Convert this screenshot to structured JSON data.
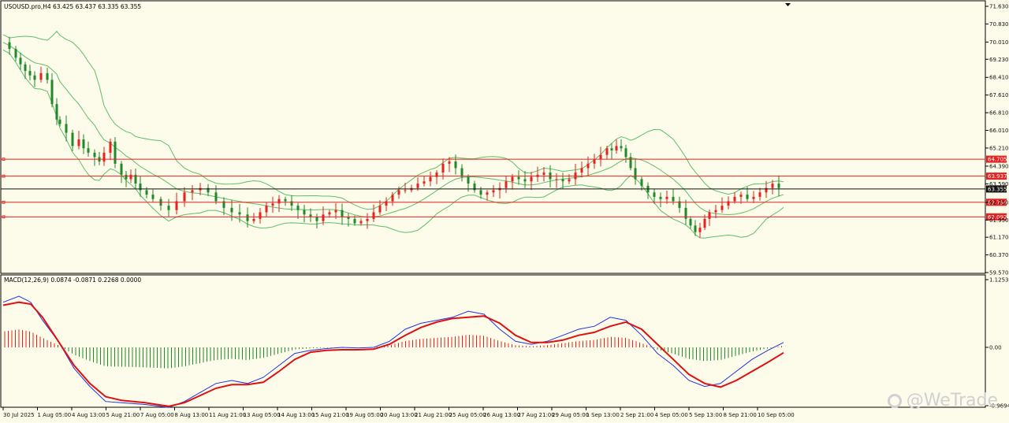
{
  "main": {
    "header": "USOUSD.pro,H4  63.425 63.437 63.335 63.355",
    "y_ticks": [
      "71.630",
      "70.830",
      "70.010",
      "69.230",
      "68.410",
      "67.610",
      "66.810",
      "66.010",
      "65.210",
      "64.390",
      "63.590",
      "62.750",
      "61.950",
      "61.170",
      "60.370",
      "59.570"
    ],
    "levels": [
      {
        "label": "64.705",
        "value": 64.705,
        "color": "#e8201f"
      },
      {
        "label": "63.937",
        "value": 63.937,
        "color": "#e8201f"
      },
      {
        "label": "62.754",
        "value": 62.754,
        "color": "#e8201f"
      },
      {
        "label": "62.092",
        "value": 62.092,
        "color": "#e8201f"
      }
    ],
    "current": {
      "label": "63.355",
      "value": 63.355,
      "color": "#111111"
    }
  },
  "macd_panel": {
    "header": "MACD(12,26,9) 0.0874 -0.0871 0.2268 0.0000",
    "y_ticks": [
      "1.1253",
      "0.00",
      "-0.9694"
    ]
  },
  "x_ticks": [
    "30 Jul 2025",
    "1 Aug 05:00",
    "4 Aug 13:00",
    "5 Aug 21:00",
    "7 Aug 05:00",
    "8 Aug 13:00",
    "11 Aug 21:00",
    "13 Aug 05:00",
    "14 Aug 13:00",
    "15 Aug 21:00",
    "19 Aug 05:00",
    "20 Aug 13:00",
    "21 Aug 21:00",
    "25 Aug 05:00",
    "26 Aug 13:00",
    "27 Aug 21:00",
    "29 Aug 05:00",
    "1 Sep 13:00",
    "2 Sep 21:00",
    "4 Sep 05:00",
    "5 Sep 13:00",
    "8 Sep 21:00",
    "10 Sep 05:00"
  ],
  "watermark": "@WeTrade",
  "colors": {
    "bull": "#e8201f",
    "bear": "#1f8a2a",
    "band": "#5cc06a",
    "macd": "#2233dd",
    "signal": "#dd1111",
    "hist_pos": "#e8201f",
    "hist_neg": "#1f8a2a",
    "background": "#fdfbea"
  },
  "chart_data": [
    {
      "type": "candlestick",
      "symbol": "USOUSD.pro",
      "timeframe": "H4",
      "ohlc": {
        "open": 63.425,
        "high": 63.437,
        "low": 63.335,
        "close": 63.355
      },
      "ylim": [
        59.57,
        71.63
      ],
      "close_path": {
        "x": [
          0,
          8,
          16,
          22,
          28,
          34,
          40,
          48,
          56,
          62,
          68,
          72,
          80,
          88,
          96,
          102,
          108,
          116,
          122,
          128,
          136,
          142,
          150,
          156,
          162,
          168,
          174,
          182,
          190,
          200,
          210,
          220,
          230,
          240,
          250,
          260,
          270,
          280,
          290,
          300,
          310,
          318,
          326,
          334,
          342,
          350,
          358,
          366,
          374,
          382,
          390,
          398,
          406,
          414,
          422,
          430,
          438,
          446,
          454,
          462,
          470,
          478,
          486,
          494,
          502,
          510,
          518,
          526,
          534,
          542,
          550,
          558,
          566,
          574,
          582,
          590,
          598,
          606,
          614,
          622,
          630,
          638,
          646,
          654,
          662,
          670,
          678,
          686,
          694,
          702,
          710,
          718,
          726,
          734,
          742,
          750,
          758,
          766,
          772,
          778,
          784,
          790,
          796,
          802,
          810,
          818,
          826,
          834,
          842,
          850,
          858,
          866,
          872,
          878,
          884,
          890,
          896,
          904,
          912,
          920,
          928,
          936,
          944,
          952,
          960,
          968,
          976,
          984,
          990
        ],
        "values": [
          70.0,
          69.7,
          69.3,
          69.0,
          68.7,
          68.5,
          68.3,
          68.6,
          68.3,
          67.2,
          66.5,
          66.3,
          65.9,
          65.3,
          65.6,
          65.2,
          65.0,
          64.8,
          64.6,
          65.0,
          65.5,
          64.5,
          64.0,
          63.8,
          64.0,
          63.6,
          63.3,
          63.1,
          62.9,
          62.6,
          62.4,
          62.8,
          63.2,
          63.3,
          63.4,
          63.2,
          62.8,
          62.5,
          62.3,
          62.2,
          61.9,
          62.0,
          62.3,
          62.6,
          62.7,
          62.9,
          62.8,
          62.6,
          62.4,
          62.2,
          62.1,
          61.9,
          62.2,
          62.3,
          62.4,
          62.1,
          62.0,
          61.8,
          61.9,
          62.0,
          62.3,
          62.6,
          62.8,
          63.1,
          63.3,
          63.3,
          63.4,
          63.6,
          63.7,
          63.9,
          64.1,
          64.5,
          64.6,
          64.3,
          63.9,
          63.6,
          63.3,
          63.1,
          63.2,
          63.3,
          63.4,
          63.7,
          63.9,
          63.8,
          63.7,
          63.9,
          64.0,
          64.1,
          63.8,
          63.8,
          63.7,
          63.8,
          64.1,
          64.3,
          64.5,
          64.7,
          64.9,
          65.2,
          65.1,
          65.3,
          65.2,
          64.8,
          64.3,
          63.8,
          63.5,
          63.2,
          63.0,
          62.9,
          63.0,
          62.8,
          62.5,
          62.0,
          61.7,
          61.4,
          61.6,
          62.0,
          62.3,
          62.4,
          62.6,
          62.8,
          63.0,
          63.1,
          62.9,
          63.0,
          63.2,
          63.4,
          63.6,
          63.4
        ]
      }
    },
    {
      "type": "line",
      "title": "MACD(12,26,9)",
      "macd_value": 0.0874,
      "signal_value": -0.0871,
      "values_header": [
        0.0874,
        -0.0871,
        0.2268,
        0.0
      ],
      "ylim": [
        -0.9694,
        1.1253
      ],
      "x": [
        0,
        20,
        35,
        50,
        70,
        90,
        110,
        130,
        150,
        180,
        210,
        230,
        250,
        270,
        290,
        310,
        330,
        350,
        370,
        390,
        410,
        430,
        450,
        470,
        490,
        510,
        530,
        550,
        570,
        590,
        610,
        630,
        650,
        670,
        690,
        710,
        730,
        750,
        770,
        790,
        810,
        830,
        850,
        870,
        890,
        910,
        930,
        950,
        970,
        990
      ],
      "series": [
        {
          "name": "MACD",
          "values": [
            0.75,
            0.85,
            0.75,
            0.45,
            0.1,
            -0.35,
            -0.65,
            -0.9,
            -0.92,
            -0.95,
            -1.0,
            -0.9,
            -0.75,
            -0.6,
            -0.55,
            -0.6,
            -0.5,
            -0.3,
            -0.1,
            -0.05,
            -0.02,
            0.0,
            -0.01,
            0.0,
            0.1,
            0.3,
            0.4,
            0.45,
            0.5,
            0.6,
            0.55,
            0.3,
            0.1,
            0.05,
            0.1,
            0.2,
            0.3,
            0.35,
            0.5,
            0.45,
            0.2,
            -0.1,
            -0.3,
            -0.55,
            -0.65,
            -0.6,
            -0.4,
            -0.2,
            -0.05,
            0.08
          ]
        },
        {
          "name": "Signal",
          "values": [
            0.7,
            0.75,
            0.72,
            0.5,
            0.1,
            -0.3,
            -0.6,
            -0.82,
            -0.88,
            -0.92,
            -0.98,
            -0.92,
            -0.8,
            -0.68,
            -0.62,
            -0.62,
            -0.58,
            -0.4,
            -0.2,
            -0.08,
            -0.05,
            -0.04,
            -0.04,
            -0.03,
            0.05,
            0.2,
            0.33,
            0.42,
            0.48,
            0.5,
            0.52,
            0.4,
            0.2,
            0.08,
            0.08,
            0.12,
            0.2,
            0.25,
            0.35,
            0.42,
            0.3,
            0.05,
            -0.2,
            -0.45,
            -0.6,
            -0.66,
            -0.55,
            -0.4,
            -0.25,
            -0.09
          ]
        }
      ]
    }
  ]
}
